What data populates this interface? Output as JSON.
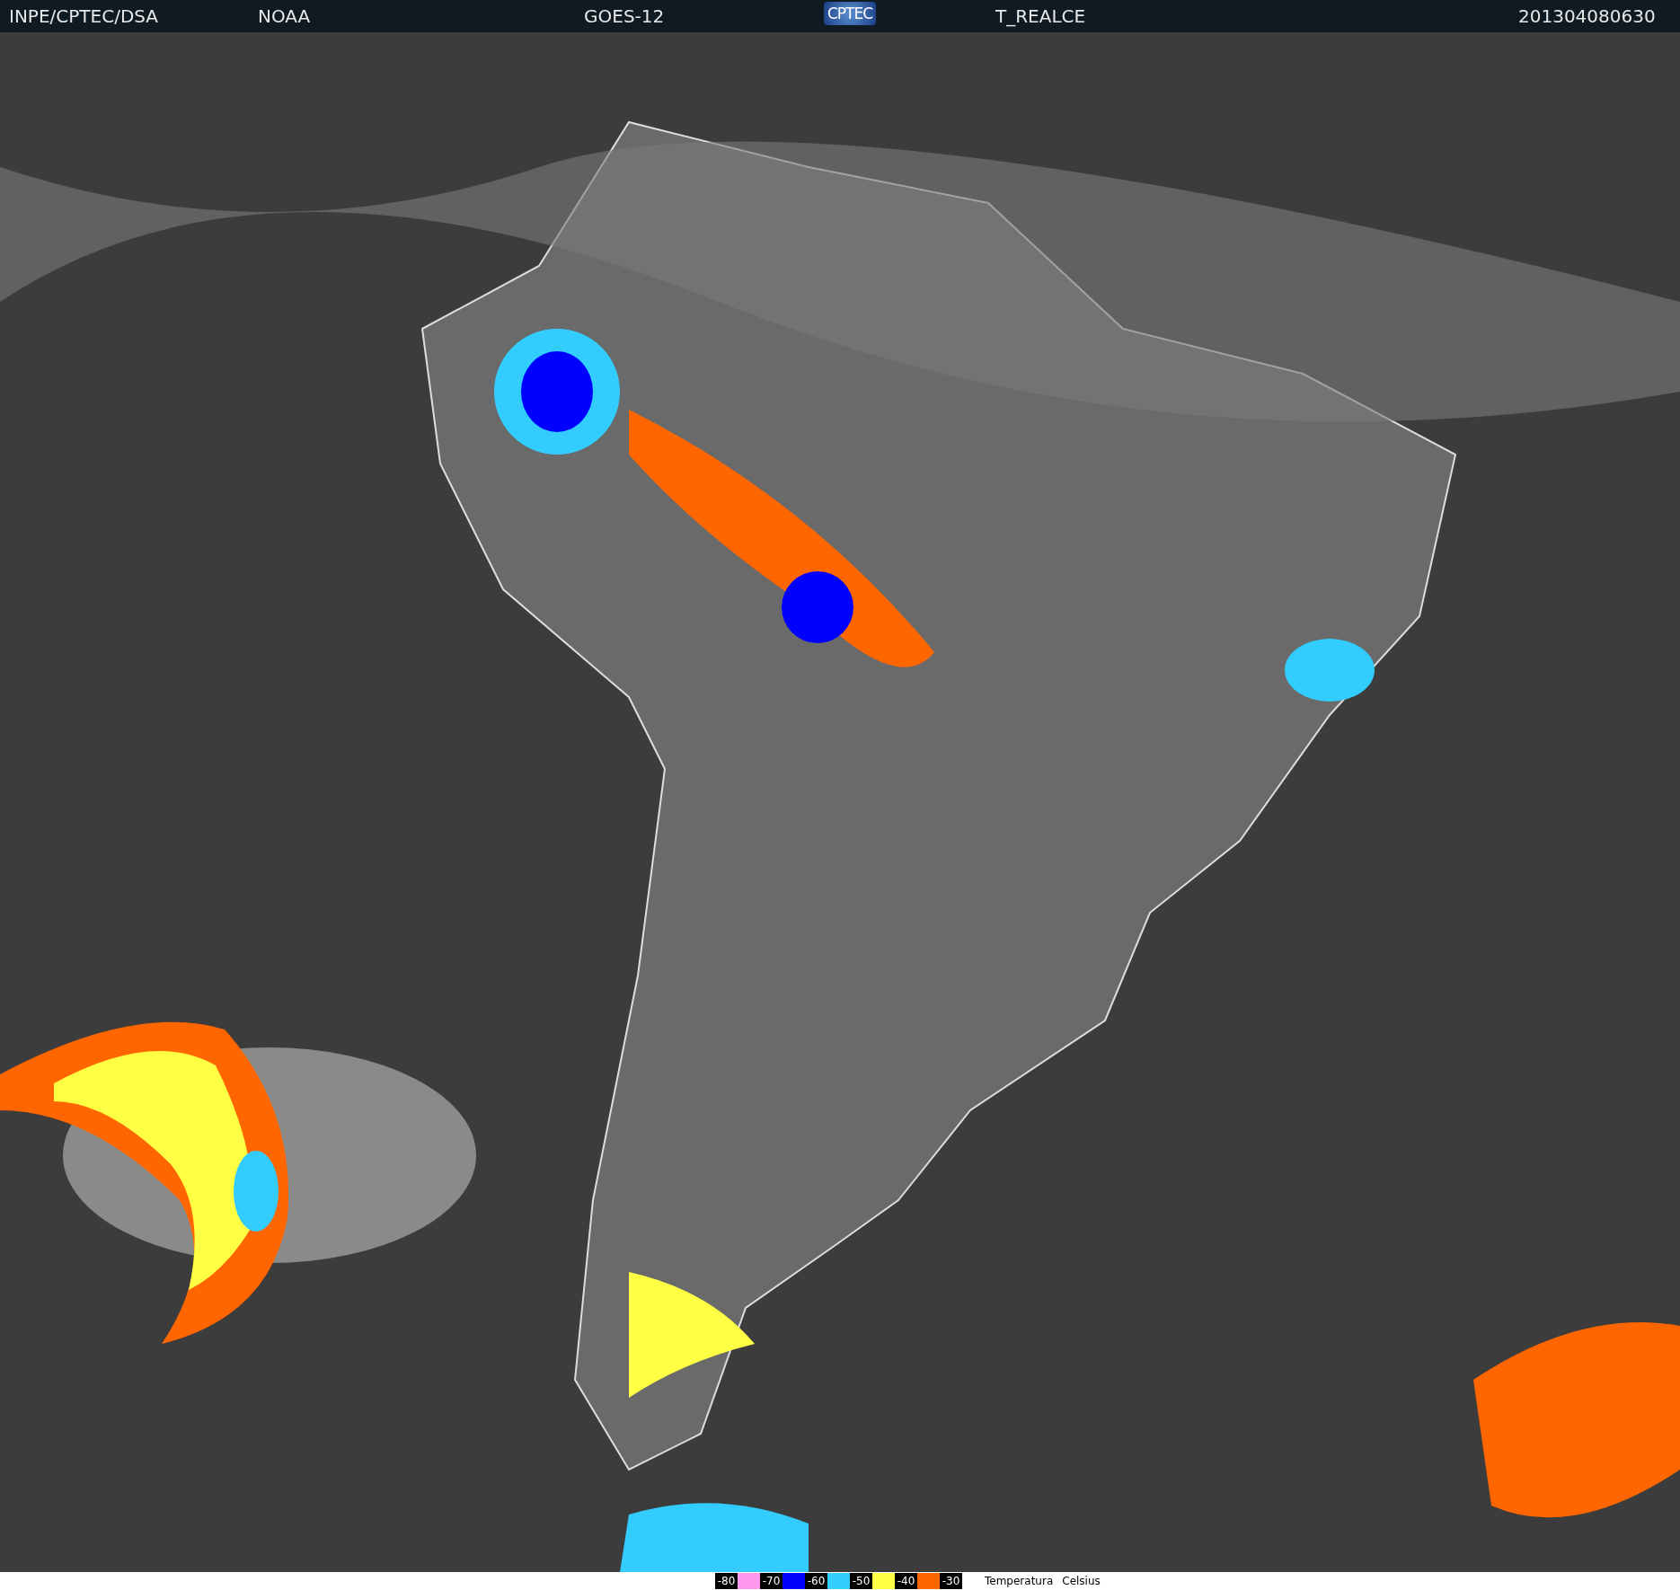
{
  "header": {
    "labels": [
      "INPE/CPTEC/DSA",
      "NOAA",
      "GOES-12"
    ],
    "logo": "CPTEC",
    "product": "T_REALCE",
    "timestamp": "201304080630"
  },
  "legend": {
    "items": [
      {
        "kind": "label",
        "text": "-80"
      },
      {
        "kind": "swatch",
        "color": "#ff99f0"
      },
      {
        "kind": "label",
        "text": "-70"
      },
      {
        "kind": "swatch",
        "color": "#0000ff"
      },
      {
        "kind": "label",
        "text": "-60"
      },
      {
        "kind": "swatch",
        "color": "#33ccff"
      },
      {
        "kind": "label",
        "text": "-50"
      },
      {
        "kind": "swatch",
        "color": "#ffff44"
      },
      {
        "kind": "label",
        "text": "-40"
      },
      {
        "kind": "swatch",
        "color": "#ff6600"
      },
      {
        "kind": "label",
        "text": "-30"
      }
    ],
    "title": "Temperatura",
    "unit": "Celsius"
  }
}
